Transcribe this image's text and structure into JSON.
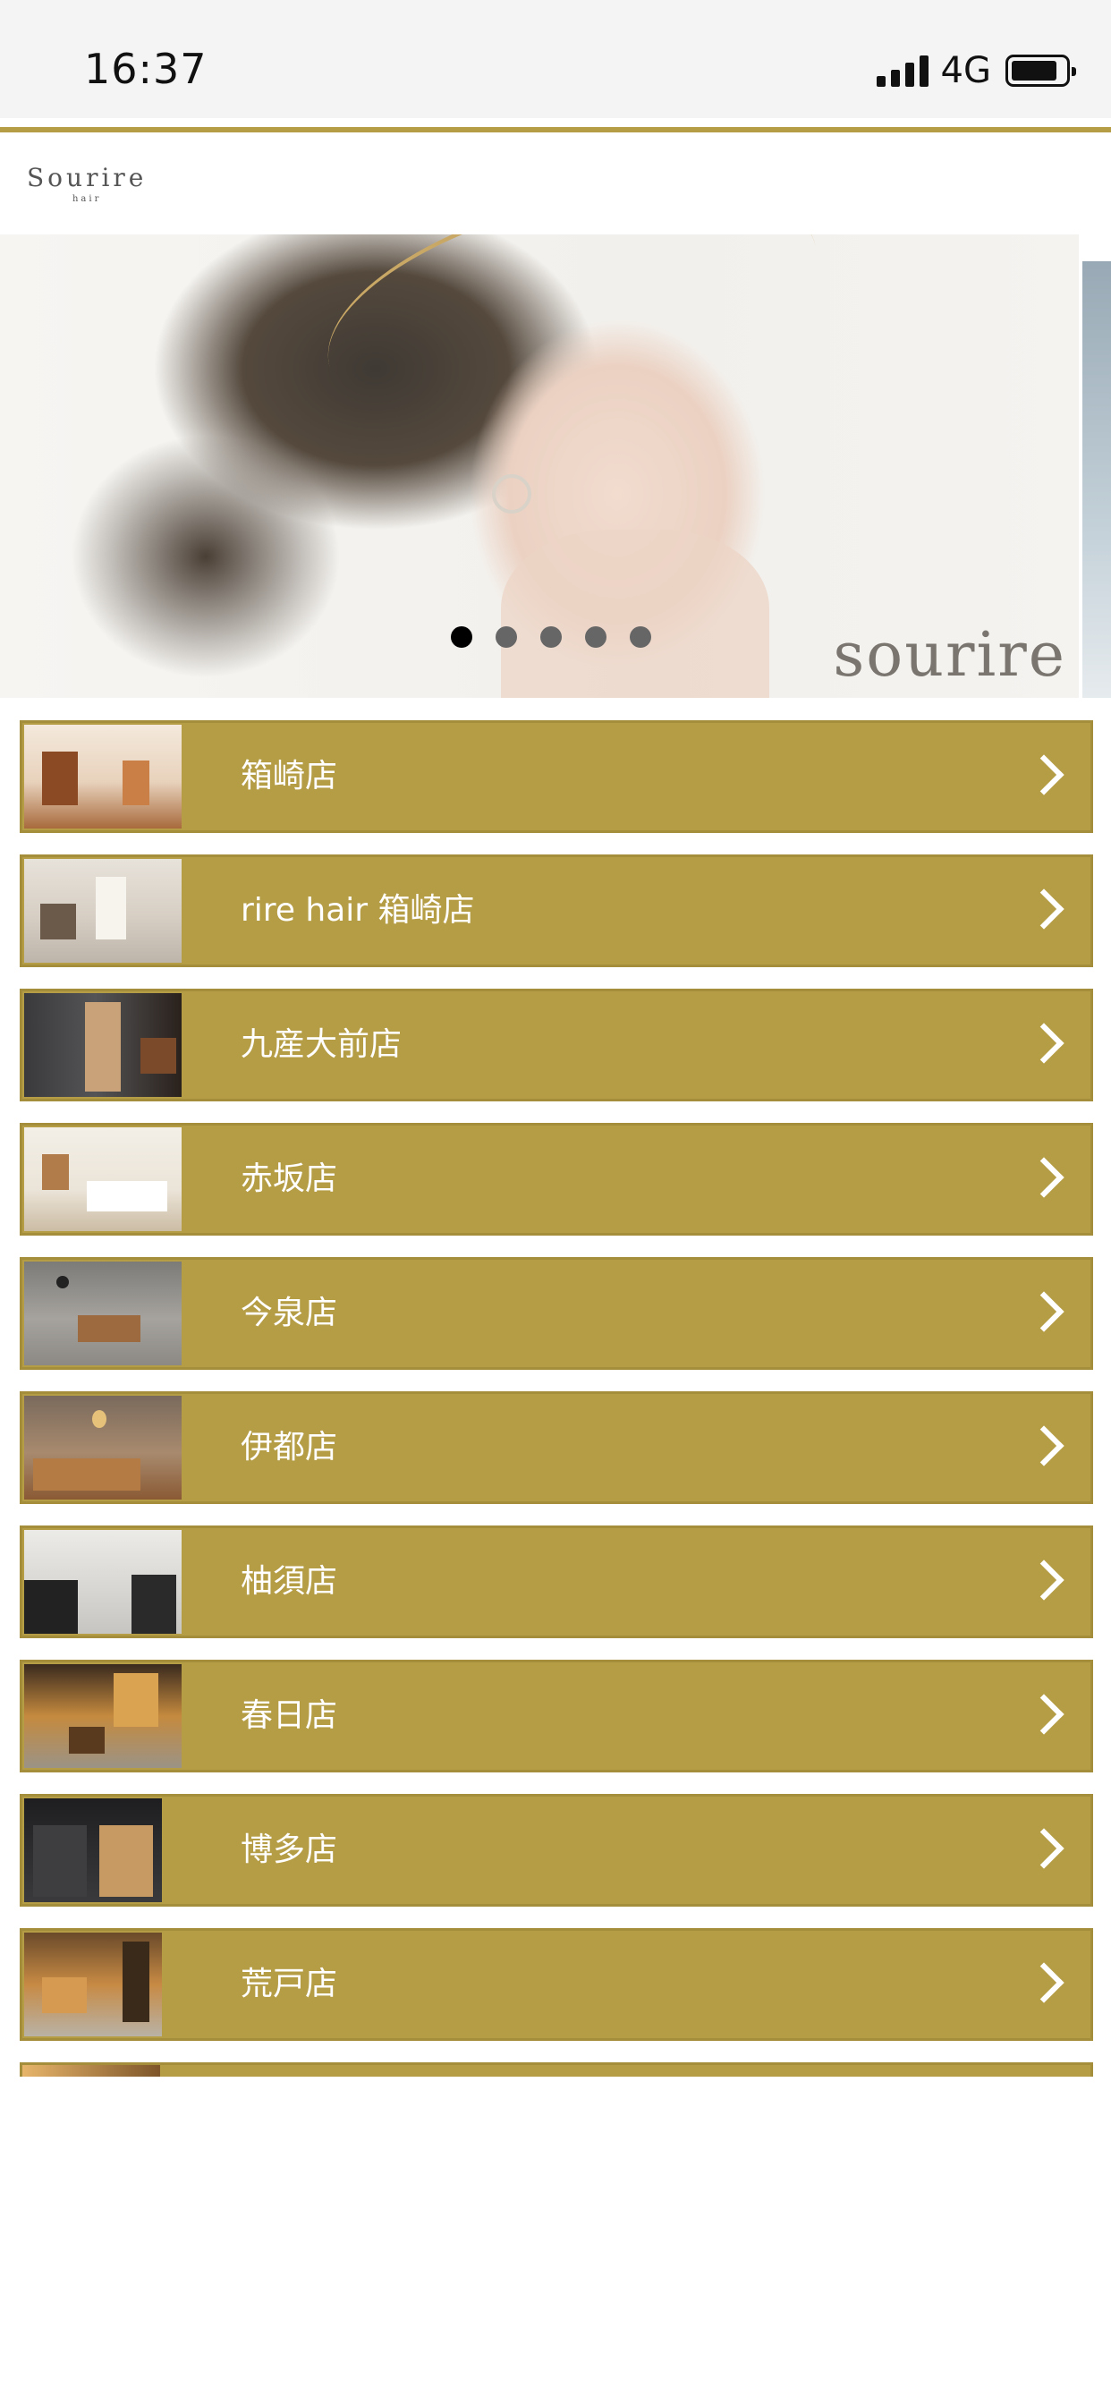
{
  "status_bar": {
    "time": "16:37",
    "network": "4G",
    "icons": [
      "signal-icon",
      "battery-icon"
    ]
  },
  "header": {
    "logo_main": "Sourire",
    "logo_sub": "hair"
  },
  "hero": {
    "watermark": "sourire",
    "slide_count": 5,
    "active_slide": 1
  },
  "stores": [
    {
      "name": "箱崎店",
      "icon": "chevron-right-icon"
    },
    {
      "name": "rire hair 箱崎店",
      "icon": "chevron-right-icon"
    },
    {
      "name": "九産大前店",
      "icon": "chevron-right-icon"
    },
    {
      "name": "赤坂店",
      "icon": "chevron-right-icon"
    },
    {
      "name": "今泉店",
      "icon": "chevron-right-icon"
    },
    {
      "name": "伊都店",
      "icon": "chevron-right-icon"
    },
    {
      "name": "柚須店",
      "icon": "chevron-right-icon"
    },
    {
      "name": "春日店",
      "icon": "chevron-right-icon"
    },
    {
      "name": "博多店",
      "icon": "chevron-right-icon"
    },
    {
      "name": "荒戸店",
      "icon": "chevron-right-icon"
    }
  ],
  "colors": {
    "accent_gold": "#b59d46",
    "status_bar_bg": "#f4f4f4",
    "text_white": "#ffffff"
  }
}
